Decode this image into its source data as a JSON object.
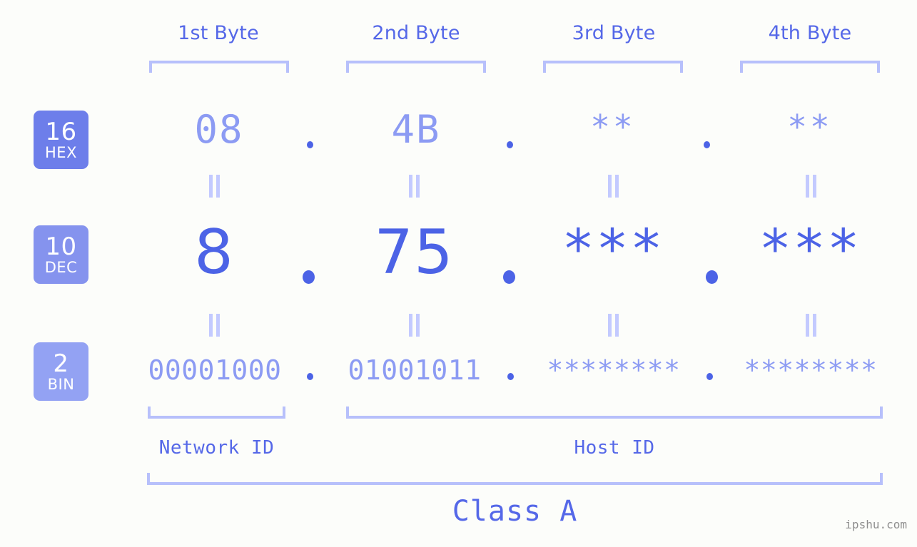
{
  "meta": {
    "background_color": "#fcfdfa",
    "accent_strong": "#4c63e6",
    "accent_mid": "#5568e8",
    "accent_light": "#8c9bf3",
    "accent_pale": "#b7c0fb",
    "watermark": "ipshu.com"
  },
  "headers": {
    "byte1": "1st Byte",
    "byte2": "2nd Byte",
    "byte3": "3rd Byte",
    "byte4": "4th Byte"
  },
  "bases": [
    {
      "number": "16",
      "name": "HEX",
      "color": "#6d7eea"
    },
    {
      "number": "10",
      "name": "DEC",
      "color": "#8593ee"
    },
    {
      "number": "2",
      "name": "BIN",
      "color": "#93a2f3"
    }
  ],
  "rows": {
    "hex": {
      "base_number": "16",
      "base_name": "HEX",
      "values": [
        "08",
        "4B",
        "**",
        "**"
      ],
      "separators": [
        ".",
        ".",
        "."
      ]
    },
    "dec": {
      "base_number": "10",
      "base_name": "DEC",
      "values": [
        "8",
        "75",
        "***",
        "***"
      ],
      "separators": [
        ".",
        ".",
        "."
      ]
    },
    "bin": {
      "base_number": "2",
      "base_name": "BIN",
      "values": [
        "00001000",
        "01001011",
        "********",
        "********"
      ],
      "separators": [
        ".",
        ".",
        "."
      ]
    }
  },
  "equals_symbol": "||",
  "footer": {
    "network_id_label": "Network ID",
    "host_id_label": "Host ID",
    "class_label": "Class A"
  }
}
